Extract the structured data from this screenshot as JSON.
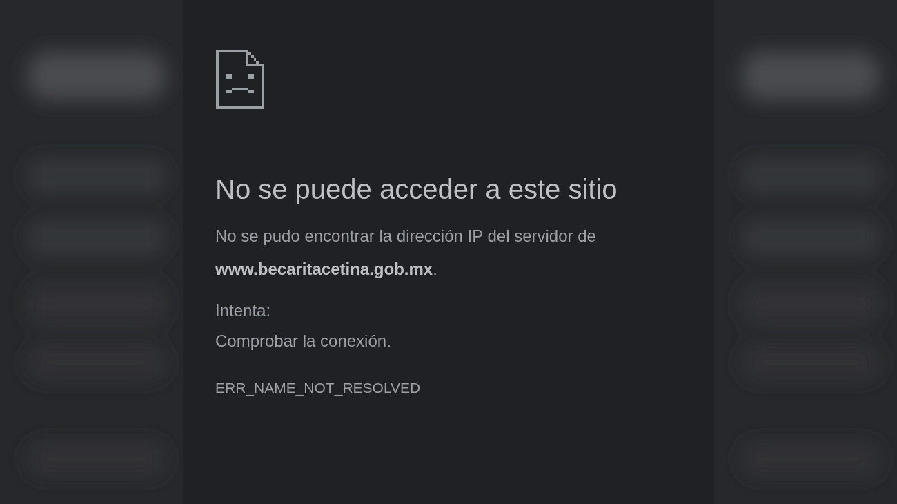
{
  "error_page": {
    "title": "No se puede acceder a este sitio",
    "message": "No se pudo encontrar la dirección IP del servidor de **www.becaritacetina.gob.mx**.",
    "suggestions_heading": "Intenta:",
    "suggestions": [
      "Comprobar la conexión."
    ],
    "error_code": "ERR_NAME_NOT_RESOLVED"
  }
}
